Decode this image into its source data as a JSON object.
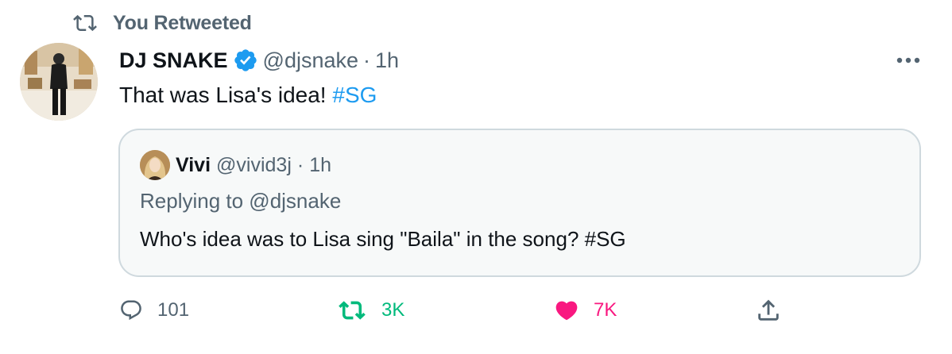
{
  "retweet_context": {
    "label": "You Retweeted",
    "icon": "retweet-icon"
  },
  "tweet": {
    "author_name": "DJ SNAKE",
    "author_handle": "@djsnake",
    "separator": "·",
    "time": "1h",
    "text": "That was Lisa's idea! ",
    "hashtag": "#SG",
    "more_icon": "more-icon"
  },
  "quoted_tweet": {
    "author_name": "Vivi",
    "author_handle": "@vivid3j",
    "separator": "·",
    "time": "1h",
    "replying_to": "Replying to @djsnake",
    "text": "Who's idea was to Lisa sing \"Baila\" in the song? #SG"
  },
  "actions": {
    "reply_count": "101",
    "retweet_count": "3K",
    "like_count": "7K"
  },
  "colors": {
    "accent_blue": "#1d9bf0",
    "retweet_green": "#00ba7c",
    "like_pink": "#f91880",
    "muted_gray": "#536471",
    "quote_border": "#cfd9de",
    "quote_background": "#f7f9f9"
  }
}
